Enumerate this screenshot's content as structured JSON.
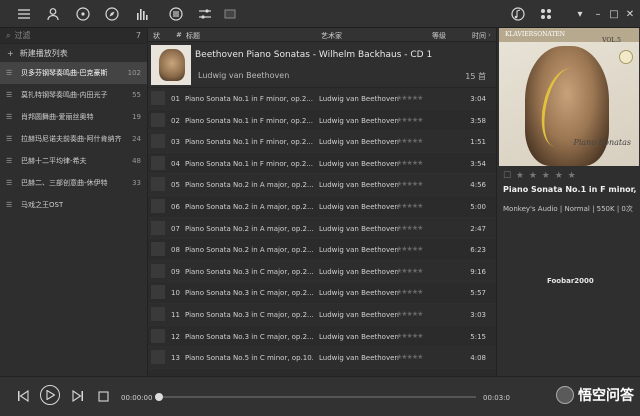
{
  "toolbar": {
    "left_icons": [
      "list-icon",
      "user-icon",
      "disc-icon",
      "compass-icon",
      "equalizer-icon",
      "menu-circle-icon",
      "sliders-icon",
      "window-icon"
    ],
    "right_icons": [
      "music-note-icon",
      "grid-icon",
      "chevron-down-icon",
      "minimize-icon",
      "maximize-icon",
      "close-icon"
    ]
  },
  "sidebar": {
    "filter_placeholder": "过滤",
    "count": "7",
    "new_playlist": "新建播放列表",
    "items": [
      {
        "name": "贝多芬钢琴奏鸣曲-巴克豪斯",
        "count": "102",
        "active": true
      },
      {
        "name": "莫扎特钢琴奏鸣曲-内田光子",
        "count": "55"
      },
      {
        "name": "肖邦圆舞曲-爱丽丝奥特",
        "count": "19"
      },
      {
        "name": "拉赫玛尼诺夫前奏曲-阿什肯纳齐",
        "count": "24"
      },
      {
        "name": "巴赫十二平均律-希夫",
        "count": "48"
      },
      {
        "name": "巴赫二、三部创意曲-休伊特",
        "count": "33"
      },
      {
        "name": "马戏之王OST",
        "count": ""
      }
    ]
  },
  "columns": {
    "status": "状",
    "num": "#",
    "title": "标题",
    "artist": "艺术家",
    "rating": "等级",
    "time": "时间"
  },
  "album": {
    "title": "Beethoven Piano Sonatas - Wilhelm Backhaus - CD 1",
    "artist": "Ludwig van Beethoven",
    "track_count": "15 首"
  },
  "tracks": [
    {
      "num": "01",
      "title": "Piano Sonata No.1 in F minor, op.2...",
      "artist": "Ludwig van Beethoven",
      "time": "3:04"
    },
    {
      "num": "02",
      "title": "Piano Sonata No.1 in F minor, op.2...",
      "artist": "Ludwig van Beethoven",
      "time": "3:58"
    },
    {
      "num": "03",
      "title": "Piano Sonata No.1 in F minor, op.2...",
      "artist": "Ludwig van Beethoven",
      "time": "1:51"
    },
    {
      "num": "04",
      "title": "Piano Sonata No.1 in F minor, op.2...",
      "artist": "Ludwig van Beethoven",
      "time": "3:54"
    },
    {
      "num": "05",
      "title": "Piano Sonata No.2 in A major, op.2...",
      "artist": "Ludwig van Beethoven",
      "time": "4:56"
    },
    {
      "num": "06",
      "title": "Piano Sonata No.2 in A major, op.2...",
      "artist": "Ludwig van Beethoven",
      "time": "5:00"
    },
    {
      "num": "07",
      "title": "Piano Sonata No.2 in A major, op.2...",
      "artist": "Ludwig van Beethoven",
      "time": "2:47"
    },
    {
      "num": "08",
      "title": "Piano Sonata No.2 in A major, op.2...",
      "artist": "Ludwig van Beethoven",
      "time": "6:23"
    },
    {
      "num": "09",
      "title": "Piano Sonata No.3 in C major, op.2...",
      "artist": "Ludwig van Beethoven",
      "time": "9:16"
    },
    {
      "num": "10",
      "title": "Piano Sonata No.3 in C major, op.2...",
      "artist": "Ludwig van Beethoven",
      "time": "5:57"
    },
    {
      "num": "11",
      "title": "Piano Sonata No.3 in C major, op.2...",
      "artist": "Ludwig van Beethoven",
      "time": "3:03"
    },
    {
      "num": "12",
      "title": "Piano Sonata No.3 in C major, op.2...",
      "artist": "Ludwig van Beethoven",
      "time": "5:15"
    },
    {
      "num": "13",
      "title": "Piano Sonata No.5 in C minor, op.10...",
      "artist": "Ludwig van Beethoven",
      "time": "4:08"
    }
  ],
  "now_playing": {
    "cover_label": "KLAVIERSONATEN",
    "cover_vol": "VOL.5",
    "cover_subtitle": "Piano Sonatas",
    "title": "Piano Sonata No.1 in F minor, ...",
    "info": "Monkey's Audio | Normal | 550K | 0次",
    "plugin": "Foobar2000"
  },
  "player": {
    "time_elapsed": "00:00:00",
    "time_total": "00:03:0",
    "progress": 0.0,
    "watermark": "悟空问答"
  }
}
